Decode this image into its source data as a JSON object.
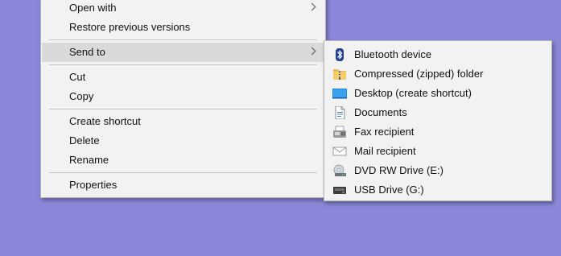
{
  "context_menu": {
    "items": [
      {
        "label": "Open with"
      },
      {
        "label": "Restore previous versions"
      },
      {
        "label": "Send to"
      },
      {
        "label": "Cut"
      },
      {
        "label": "Copy"
      },
      {
        "label": "Create shortcut"
      },
      {
        "label": "Delete"
      },
      {
        "label": "Rename"
      },
      {
        "label": "Properties"
      }
    ]
  },
  "send_to_menu": {
    "items": [
      {
        "label": "Bluetooth device",
        "icon": "bluetooth-icon"
      },
      {
        "label": "Compressed (zipped) folder",
        "icon": "zip-folder-icon"
      },
      {
        "label": "Desktop (create shortcut)",
        "icon": "desktop-icon"
      },
      {
        "label": "Documents",
        "icon": "documents-icon"
      },
      {
        "label": "Fax recipient",
        "icon": "fax-icon"
      },
      {
        "label": "Mail recipient",
        "icon": "mail-icon"
      },
      {
        "label": "DVD RW Drive (E:)",
        "icon": "dvd-drive-icon"
      },
      {
        "label": "USB Drive (G:)",
        "icon": "usb-drive-icon"
      }
    ]
  },
  "colors": {
    "desktop_background": "#8b88d9",
    "menu_background": "#f2f2f2",
    "highlight": "#dadada"
  }
}
